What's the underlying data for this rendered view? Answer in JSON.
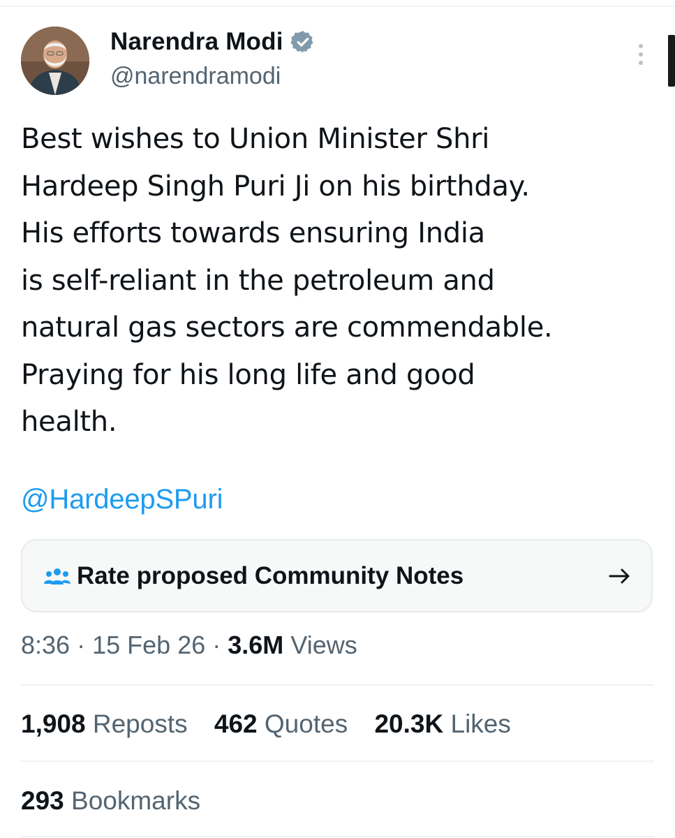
{
  "author": {
    "display_name": "Narendra Modi",
    "handle": "@narendramodi",
    "verified_icon": "verified-badge-icon",
    "avatar": "profile-photo"
  },
  "tweet": {
    "lines": [
      "Best wishes to Union Minister Shri",
      "Hardeep Singh Puri Ji on his birthday.",
      "His efforts towards ensuring India",
      "is self-reliant in the petroleum and",
      "natural gas sectors are commendable.",
      "Praying for his long life and good",
      "health."
    ],
    "mention": "@HardeepSPuri"
  },
  "community_notes": {
    "label": "Rate proposed Community Notes",
    "icon": "people-icon",
    "arrow_icon": "arrow-right-icon"
  },
  "meta": {
    "time": "8:36",
    "separator": "·",
    "date": "15 Feb 26",
    "views_count": "3.6M",
    "views_label": "Views"
  },
  "stats": {
    "reposts_count": "1,908",
    "reposts_label": "Reposts",
    "quotes_count": "462",
    "quotes_label": "Quotes",
    "likes_count": "20.3K",
    "likes_label": "Likes",
    "bookmarks_count": "293",
    "bookmarks_label": "Bookmarks"
  },
  "colors": {
    "link": "#1d9bf0",
    "text_primary": "#0f1419",
    "text_secondary": "#536471",
    "verified": "#829aab",
    "divider": "#eff3f4"
  }
}
